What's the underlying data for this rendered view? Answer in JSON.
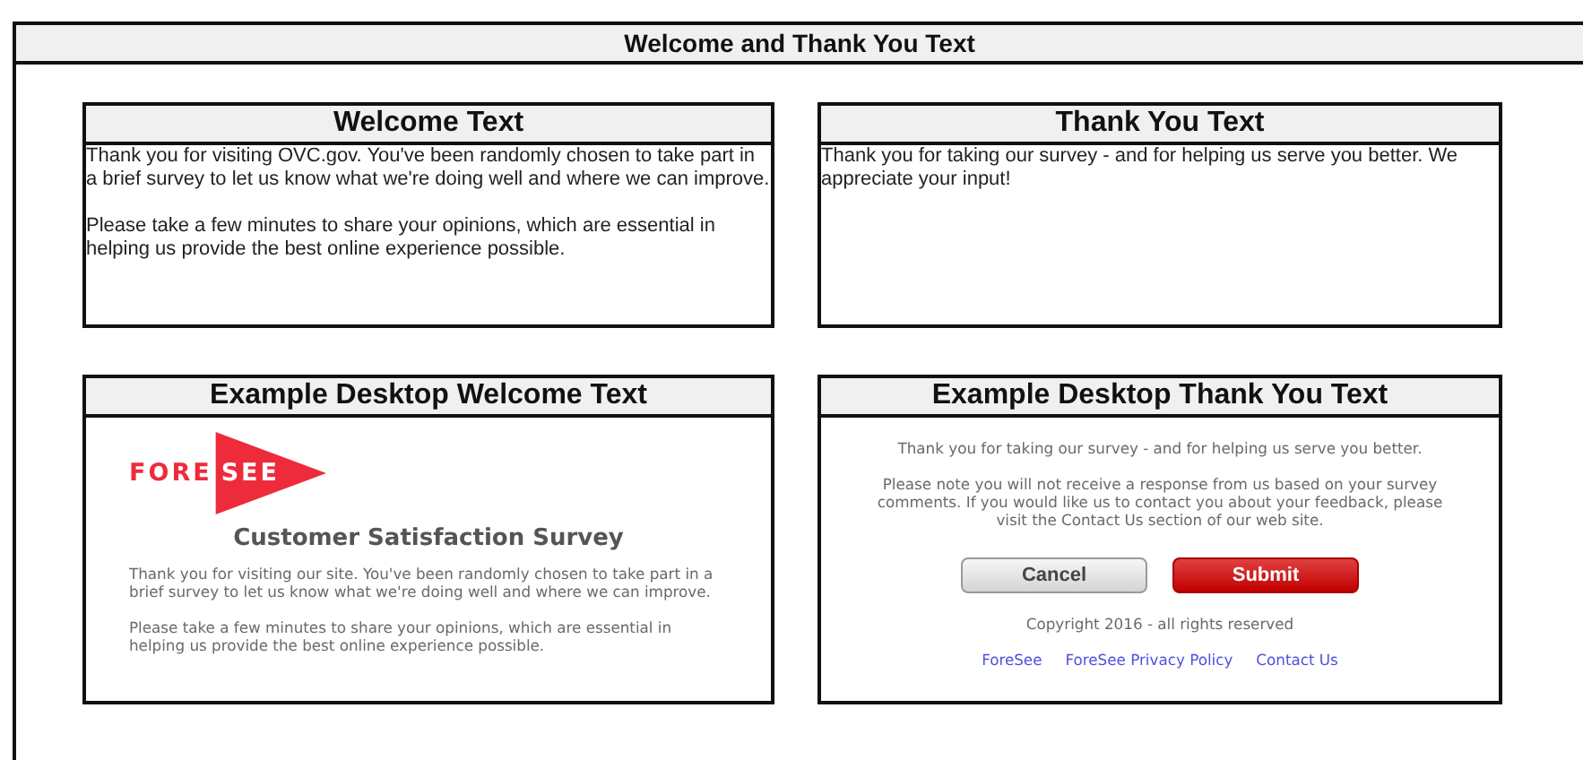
{
  "header": {
    "title": "Welcome and Thank You Text"
  },
  "welcome": {
    "title": "Welcome Text",
    "paragraphs": [
      "Thank you for visiting OVC.gov. You've been randomly chosen to take part in a brief survey to let us know what we're doing well and where we can improve.",
      "Please take a few minutes to share your opinions, which are essential in helping us provide the best online experience possible."
    ]
  },
  "thank_you": {
    "title": "Thank You Text",
    "paragraphs": [
      "Thank you for taking our survey - and for helping us serve you better. We appreciate your input!"
    ]
  },
  "example_welcome": {
    "title": "Example Desktop Welcome Text",
    "logo": {
      "prefix": "FORE",
      "suffix": "SEE"
    },
    "heading": "Customer Satisfaction Survey",
    "paragraphs": [
      "Thank you for visiting our site. You've been randomly chosen to take part in a brief survey to let us know what we're doing well and where we can improve.",
      "Please take a few minutes to share your opinions, which are essential in helping us provide the best online experience possible."
    ]
  },
  "example_thank_you": {
    "title": "Example Desktop Thank You Text",
    "paragraphs": [
      "Thank you for taking our survey - and for helping us serve you better.",
      "Please note you will not receive a response from us based on your survey comments. If you would like us to contact you about your feedback, please visit the Contact Us section of our web site."
    ],
    "buttons": [
      {
        "label": "Cancel",
        "kind": "secondary"
      },
      {
        "label": "Submit",
        "kind": "primary"
      }
    ],
    "copyright": "Copyright 2016 - all rights reserved",
    "links": [
      "ForeSee",
      "ForeSee Privacy Policy",
      "Contact Us"
    ]
  }
}
